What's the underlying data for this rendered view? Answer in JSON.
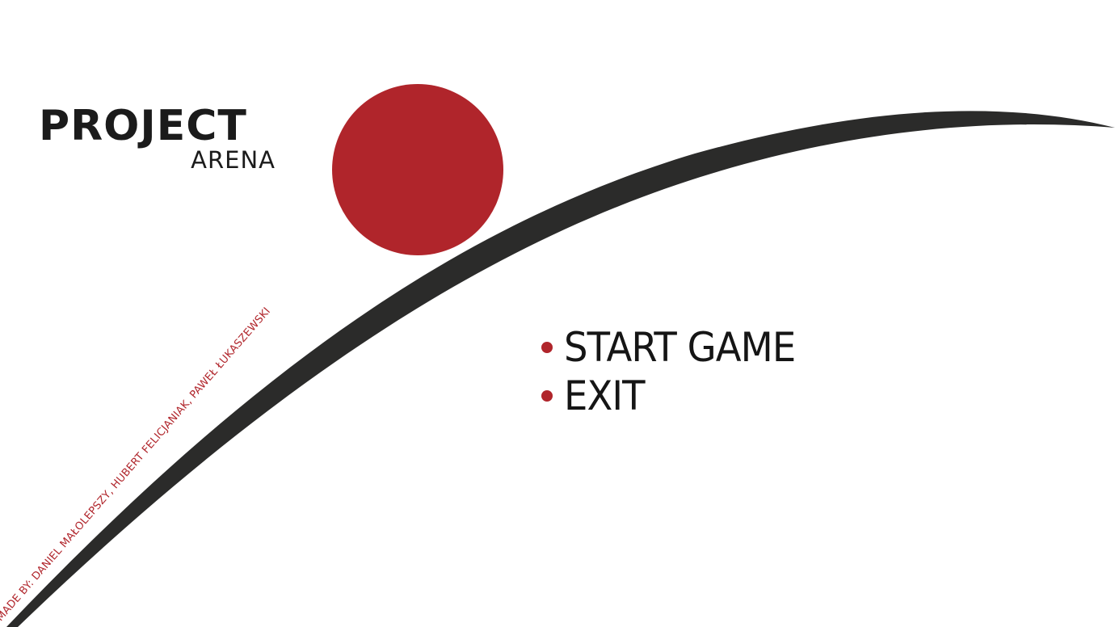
{
  "logo": {
    "title": "PROJECT",
    "subtitle": "ARENA"
  },
  "menu": {
    "items": [
      {
        "label": "START GAME"
      },
      {
        "label": "EXIT"
      }
    ]
  },
  "credits": {
    "text": "MADE BY: DANIEL MAŁOLEPSZY, HUBERT FELICJANIAK, PAWEŁ ŁUKASZEWSKI"
  },
  "colors": {
    "background": "#ffffff",
    "accent_red": "#b0252b",
    "arc_dark": "#2b2b2a",
    "text_dark": "#151515"
  },
  "icons": {
    "bullet": "bullet-dot-icon",
    "sun": "red-circle",
    "arc": "dark-crescent-arc"
  }
}
